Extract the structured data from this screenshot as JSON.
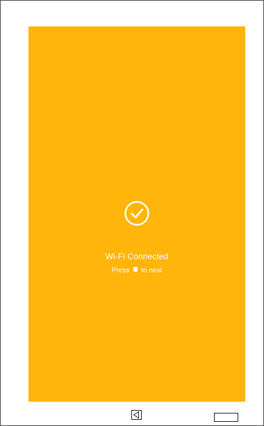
{
  "screen": {
    "background_color": "#FFB509",
    "status_icon": "check-circle-icon",
    "title": "Wi-Fi Connected",
    "hint_prefix": "Press",
    "hint_key_icon": "button-dot-icon",
    "hint_suffix": "to next"
  },
  "navigation": {
    "back_icon": "back-triangle-icon",
    "menu_icon": "rectangle-button-icon"
  }
}
